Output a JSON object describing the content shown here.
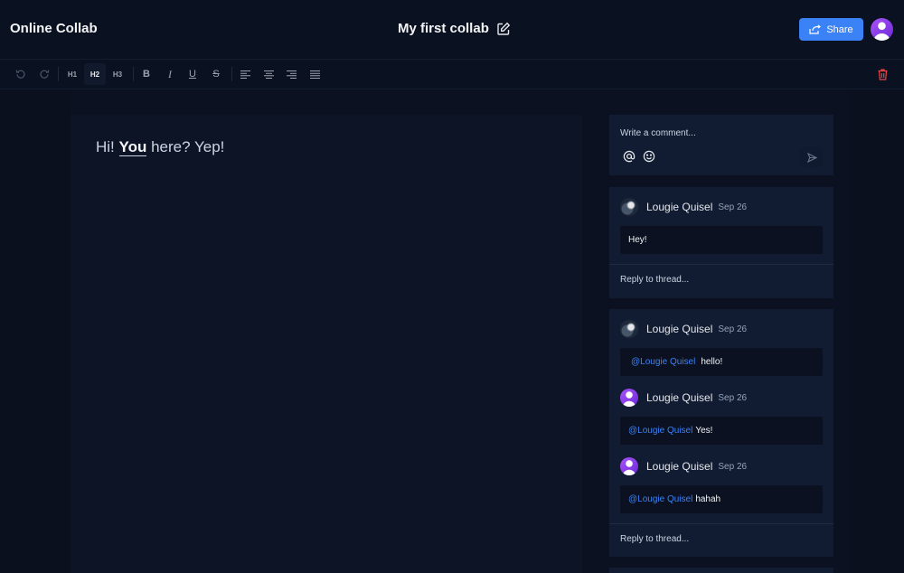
{
  "header": {
    "app_name": "Online Collab",
    "doc_title": "My first collab",
    "share_label": "Share"
  },
  "toolbar": {
    "h1": "H1",
    "h2": "H2",
    "h3": "H3",
    "bold": "B",
    "italic": "I",
    "underline": "U",
    "strike": "S",
    "active_heading": "H2"
  },
  "editor": {
    "text_before": "Hi! ",
    "text_bold": "You",
    "text_after": " here? Yep!"
  },
  "comment_box": {
    "placeholder": "Write a comment..."
  },
  "threads": [
    {
      "comments": [
        {
          "author": "Lougie Quisel",
          "date": "Sep 26",
          "mention": "",
          "text": "Hey!"
        }
      ],
      "reply_placeholder": "Reply to thread..."
    },
    {
      "comments": [
        {
          "author": "Lougie Quisel",
          "date": "Sep 26",
          "mention": "@Lougie Quisel",
          "text": "hello!"
        },
        {
          "author": "Lougie Quisel",
          "date": "Sep 26",
          "mention": "@Lougie Quisel",
          "text": "Yes!"
        },
        {
          "author": "Lougie Quisel",
          "date": "Sep 26",
          "mention": "@Lougie Quisel",
          "text": "hahah"
        }
      ],
      "reply_placeholder": "Reply to thread..."
    }
  ],
  "colors": {
    "accent": "#3b82f6",
    "danger": "#ef4444",
    "avatar": "#8b5cf6",
    "background": "#0b1120"
  },
  "icons": {
    "edit": "edit-icon",
    "share": "share-icon",
    "undo": "undo-icon",
    "redo": "redo-icon",
    "delete": "trash-icon",
    "mention": "at-icon",
    "emoji": "smile-icon",
    "send": "send-icon"
  }
}
